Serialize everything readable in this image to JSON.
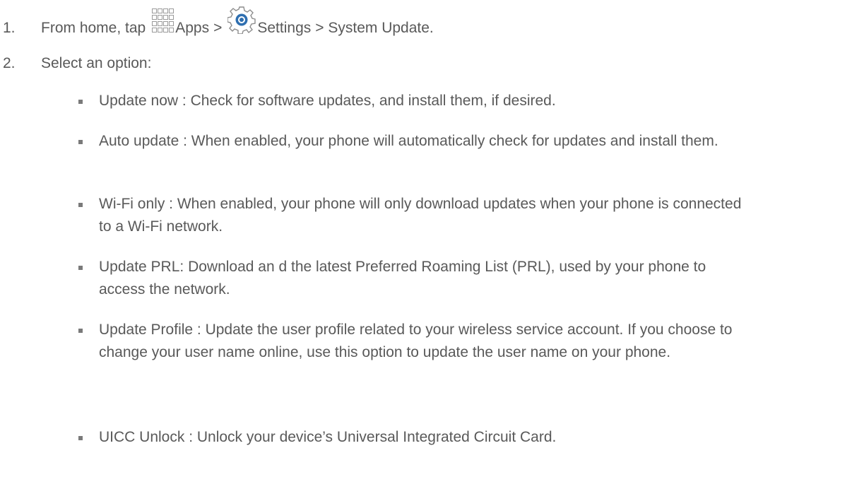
{
  "steps": [
    {
      "number": "1.",
      "parts": {
        "prefix": "From home, tap",
        "apps_label": "Apps",
        "sep1": ">",
        "settings_label": "Settings",
        "suffix": "> System Update."
      },
      "icons": [
        "apps-grid-icon",
        "settings-gear-icon"
      ]
    },
    {
      "number": "2.",
      "text": "Select an option:"
    }
  ],
  "options": [
    {
      "text": "Update now : Check for software updates, and install them, if desired."
    },
    {
      "text": "Auto update  : When enabled, your phone will automatically check for updates and install them."
    },
    {
      "text": "Wi-Fi only : When enabled, your phone will only download updates when your phone is connected to a Wi-Fi network."
    },
    {
      "text": "Update PRL: Download an d the latest Preferred Roaming List (PRL), used by your phone to access the network."
    },
    {
      "text": "Update Profile  : Update the user profile related to your wireless service account. If you choose to change your user name online, use this option to update the user name on your phone."
    },
    {
      "text": "UICC Unlock : Unlock your device’s Universal Integrated Circuit Card."
    }
  ],
  "colors": {
    "text": "#595959",
    "bullet": "#7a7a7a",
    "gear_accent": "#2f6fb0"
  }
}
